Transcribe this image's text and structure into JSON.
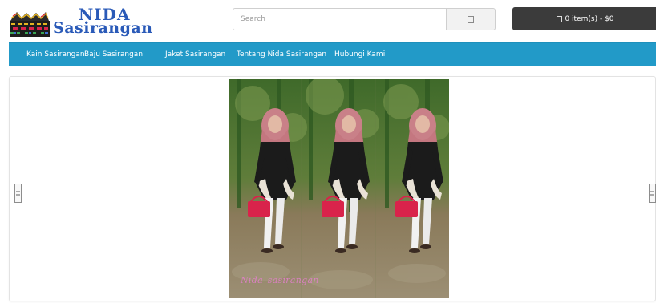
{
  "header": {
    "logo": {
      "title": "NIDA",
      "subtitle": "Sasirangan"
    },
    "search": {
      "placeholder": "Search",
      "button_icon": "search-icon"
    },
    "cart": {
      "label": "0 item(s) - $0",
      "icon": "cart-icon",
      "background": "#3b3b3b"
    }
  },
  "nav": {
    "background": "#229ac8",
    "items": [
      {
        "label": "Kain Sasirangan"
      },
      {
        "label": "Baju Sasirangan"
      },
      {
        "label": "Jaket Sasirangan"
      },
      {
        "label": "Tentang Nida Sasirangan"
      },
      {
        "label": "Hubungi Kami"
      }
    ]
  },
  "slideshow": {
    "prev_icon": "chevron-left-icon",
    "next_icon": "chevron-right-icon",
    "image": {
      "watermark": "Nida_sasirangan",
      "panels": 3
    }
  },
  "colors": {
    "brand": "#2a5ab8",
    "nav": "#229ac8",
    "accent": "#d9234b"
  }
}
